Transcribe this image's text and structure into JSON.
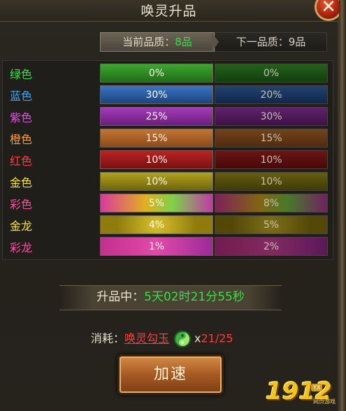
{
  "window": {
    "title": "唤灵升品",
    "close_label": "✕"
  },
  "quality": {
    "current_label": "当前品质：",
    "current_value": "8品",
    "next_text": "下一品质：9品"
  },
  "colors": {
    "green_text": "#36e047",
    "red_text": "#ff3b3b",
    "button_orange": "#c07230"
  },
  "rates": [
    {
      "name": "绿色",
      "current": "0%",
      "next": "0%"
    },
    {
      "name": "蓝色",
      "current": "30%",
      "next": "20%"
    },
    {
      "name": "紫色",
      "current": "25%",
      "next": "30%"
    },
    {
      "name": "橙色",
      "current": "15%",
      "next": "15%"
    },
    {
      "name": "红色",
      "current": "10%",
      "next": "10%"
    },
    {
      "name": "金色",
      "current": "10%",
      "next": "10%"
    },
    {
      "name": "彩色",
      "current": "5%",
      "next": "8%"
    },
    {
      "name": "金龙",
      "current": "4%",
      "next": "5%"
    },
    {
      "name": "彩龙",
      "current": "1%",
      "next": "2%"
    }
  ],
  "status": {
    "label": "升品中：",
    "time": "5天02时21分55秒"
  },
  "cost": {
    "label": "消耗：",
    "item": "唤灵勾玉",
    "icon": "jade-icon",
    "x": "x",
    "count": "21/25"
  },
  "button": {
    "label": "加速"
  },
  "watermark": {
    "logo": "1912",
    "badge": "YX",
    "site": "网页游戏"
  }
}
